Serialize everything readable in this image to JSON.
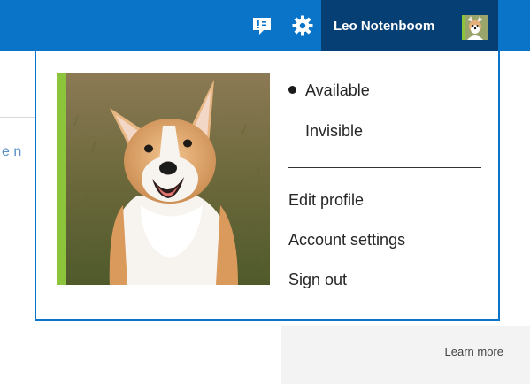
{
  "topbar": {
    "feedback_icon": "feedback-icon",
    "settings_icon": "gear-icon",
    "user_name": "Leo Notenboom",
    "avatar_icon": "avatar-dog-icon"
  },
  "profile": {
    "photo_description": "corgi-dog-photo",
    "accent_color": "#8cc43c"
  },
  "status": {
    "items": [
      {
        "label": "Available",
        "selected": true
      },
      {
        "label": "Invisible",
        "selected": false
      }
    ]
  },
  "menu": {
    "items": [
      {
        "label": "Edit profile"
      },
      {
        "label": "Account settings"
      },
      {
        "label": "Sign out"
      }
    ]
  },
  "background": {
    "fragment_text": "e n",
    "learn_more": "Learn more"
  },
  "colors": {
    "brand_blue": "#0a74c9",
    "user_button_dark": "#063f73",
    "accent_green": "#8cc43c"
  }
}
